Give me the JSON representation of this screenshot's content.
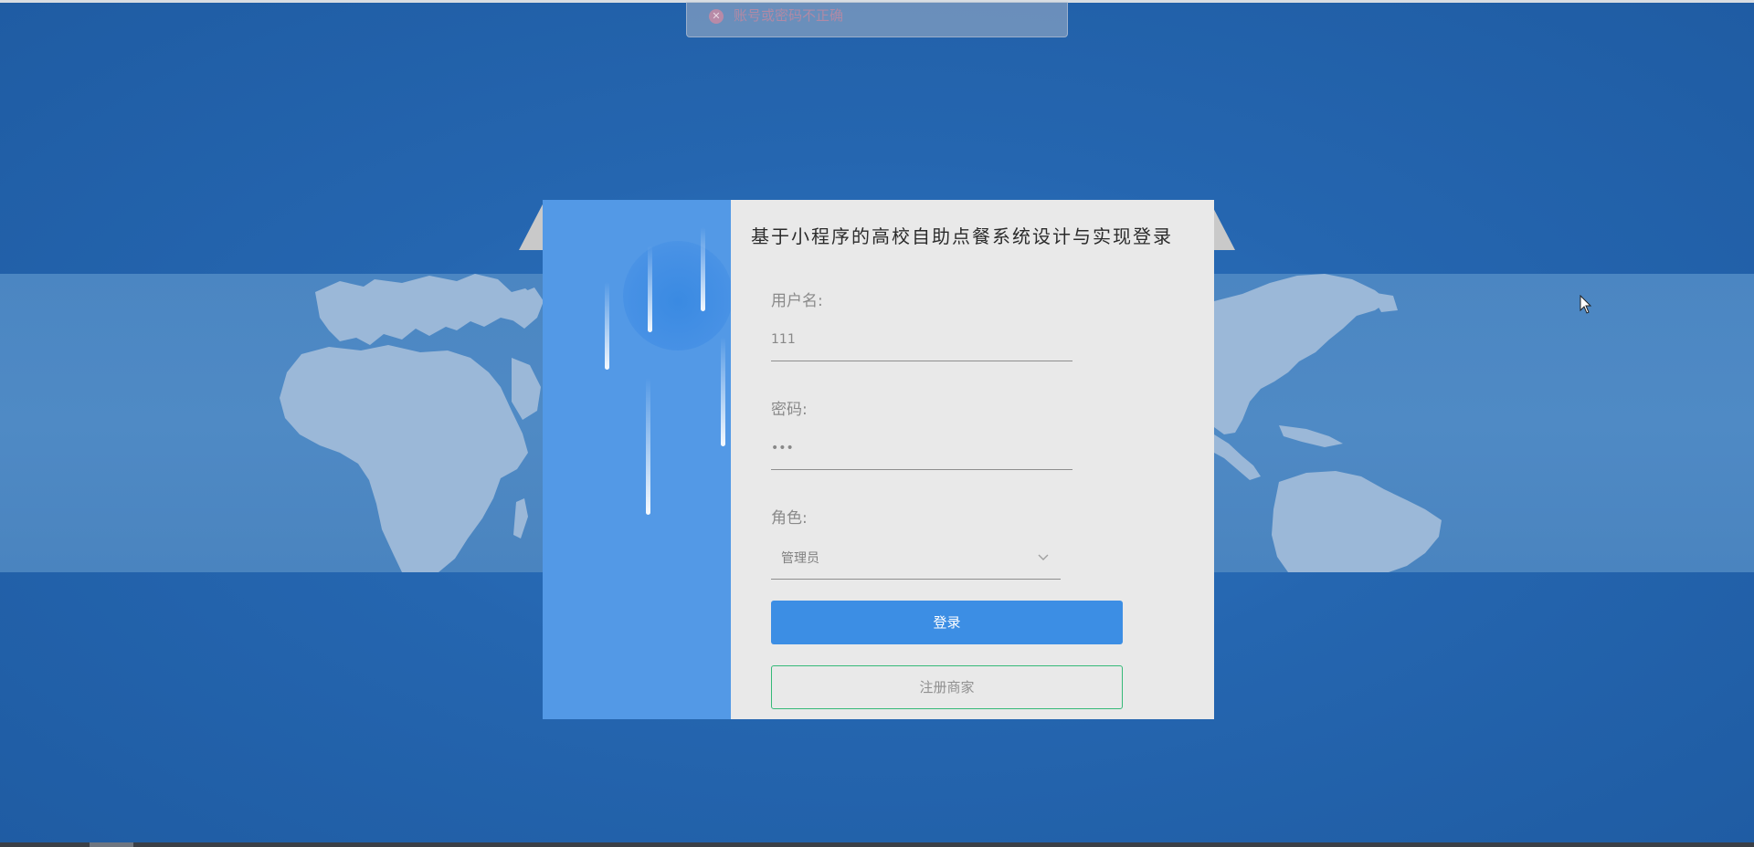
{
  "notification": {
    "type": "error",
    "icon": "close-circle-icon",
    "message": "账号或密码不正确",
    "color": "#b08aa6"
  },
  "login": {
    "title": "基于小程序的高校自助点餐系统设计与实现登录",
    "username": {
      "label": "用户名:",
      "value": "111"
    },
    "password": {
      "label": "密码:",
      "value": "•••"
    },
    "role": {
      "label": "角色:",
      "selected": "管理员"
    },
    "login_button": "登录",
    "register_button": "注册商家"
  },
  "colors": {
    "page_background": "#2566b0",
    "map_band": "#4f8ac5",
    "deco_panel": "#5399e6",
    "card": "#e9e9e9",
    "primary_button": "#3c8ee4",
    "register_border": "#35b978"
  }
}
